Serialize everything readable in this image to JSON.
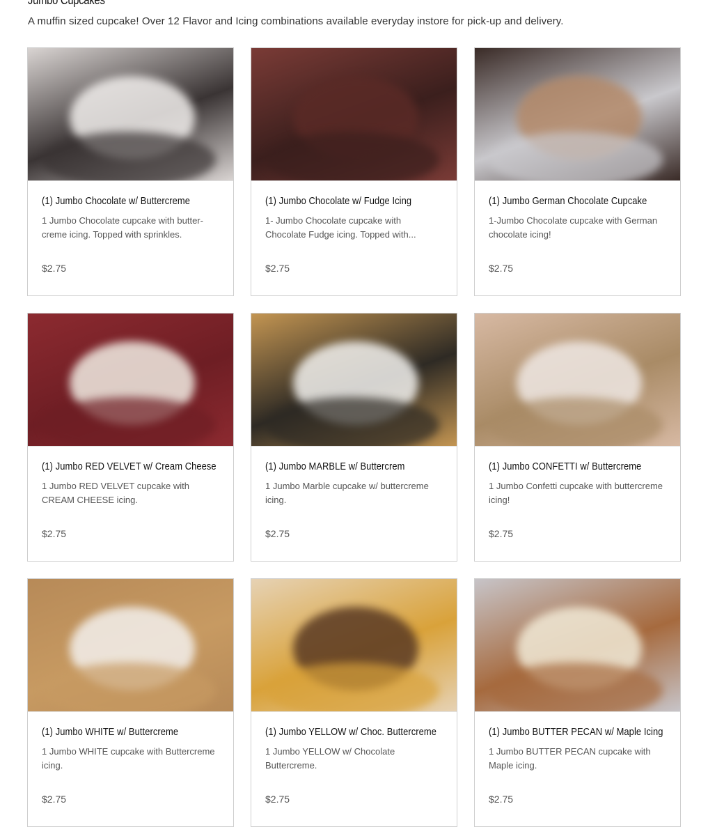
{
  "section": {
    "title": "Jumbo Cupcakes",
    "description": "A muffin sized cupcake! Over 12 Flavor and Icing combinations available everyday instore for pick-up and delivery."
  },
  "products": [
    {
      "title": "(1) Jumbo Chocolate w/ Buttercreme",
      "description": "1 Jumbo Chocolate cupcake with butter-creme icing. Topped with sprinkles.",
      "price": "$2.75",
      "photo_colors": [
        "#3a3434",
        "#f1eeec",
        "#d9d4d2"
      ]
    },
    {
      "title": "(1) Jumbo Chocolate w/ Fudge Icing",
      "description": "1- Jumbo Chocolate cupcake with Chocolate Fudge icing. Topped with...",
      "price": "$2.75",
      "photo_colors": [
        "#3b1f1d",
        "#5a2a26",
        "#7a3b36"
      ]
    },
    {
      "title": "(1) Jumbo German Chocolate Cupcake",
      "description": "1-Jumbo Chocolate cupcake with German chocolate icing!",
      "price": "$2.75",
      "photo_colors": [
        "#c9c8cc",
        "#b48a6a",
        "#3a2b27"
      ]
    },
    {
      "title": "(1) Jumbo RED VELVET w/ Cream Cheese",
      "description": "1 Jumbo RED VELVET cupcake with CREAM CHEESE icing.",
      "price": "$2.75",
      "photo_colors": [
        "#6e1e24",
        "#f1ece3",
        "#8c2a30"
      ]
    },
    {
      "title": "(1) Jumbo MARBLE w/ Buttercrem",
      "description": "1 Jumbo Marble cupcake w/ buttercreme icing.",
      "price": "$2.75",
      "photo_colors": [
        "#2e2a24",
        "#f2f1ee",
        "#c39552"
      ]
    },
    {
      "title": "(1) Jumbo CONFETTI w/ Buttercreme",
      "description": "1 Jumbo Confetti cupcake with buttercreme icing!",
      "price": "$2.75",
      "photo_colors": [
        "#a98b66",
        "#efe8e4",
        "#d7b9a3"
      ]
    },
    {
      "title": "(1) Jumbo WHITE w/ Buttercreme",
      "description": "1 Jumbo WHITE cupcake with Buttercreme icing.",
      "price": "$2.75",
      "photo_colors": [
        "#c79a62",
        "#f3f0ed",
        "#b78a58"
      ]
    },
    {
      "title": "(1) Jumbo YELLOW w/ Choc. Buttercreme",
      "description": "1 Jumbo YELLOW w/ Chocolate Buttercreme.",
      "price": "$2.75",
      "photo_colors": [
        "#d9a23a",
        "#5a3a24",
        "#e6d2b4"
      ]
    },
    {
      "title": "(1) Jumbo BUTTER PECAN w/ Maple Icing",
      "description": "1 Jumbo BUTTER PECAN cupcake with Maple icing.",
      "price": "$2.75",
      "photo_colors": [
        "#a66a3e",
        "#f1ead7",
        "#c7c4c8"
      ]
    }
  ]
}
